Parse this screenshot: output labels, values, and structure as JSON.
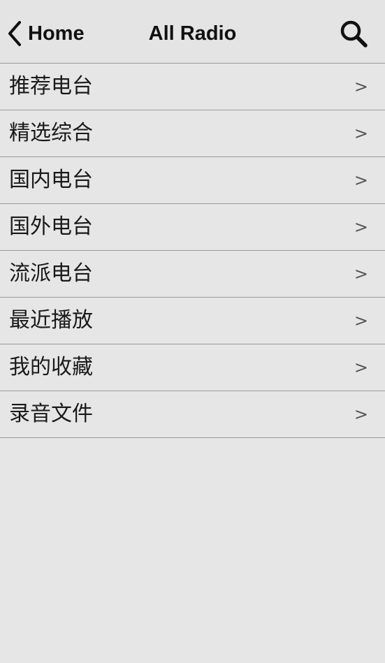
{
  "header": {
    "back_label": "Home",
    "title": "All Radio",
    "back_icon": "chevron-left-icon",
    "search_icon": "search-icon"
  },
  "list": {
    "chevron": ">",
    "items": [
      {
        "label": "推荐电台"
      },
      {
        "label": "精选综合"
      },
      {
        "label": "国内电台"
      },
      {
        "label": "国外电台"
      },
      {
        "label": "流派电台"
      },
      {
        "label": "最近播放"
      },
      {
        "label": "我的收藏"
      },
      {
        "label": "录音文件"
      }
    ]
  }
}
